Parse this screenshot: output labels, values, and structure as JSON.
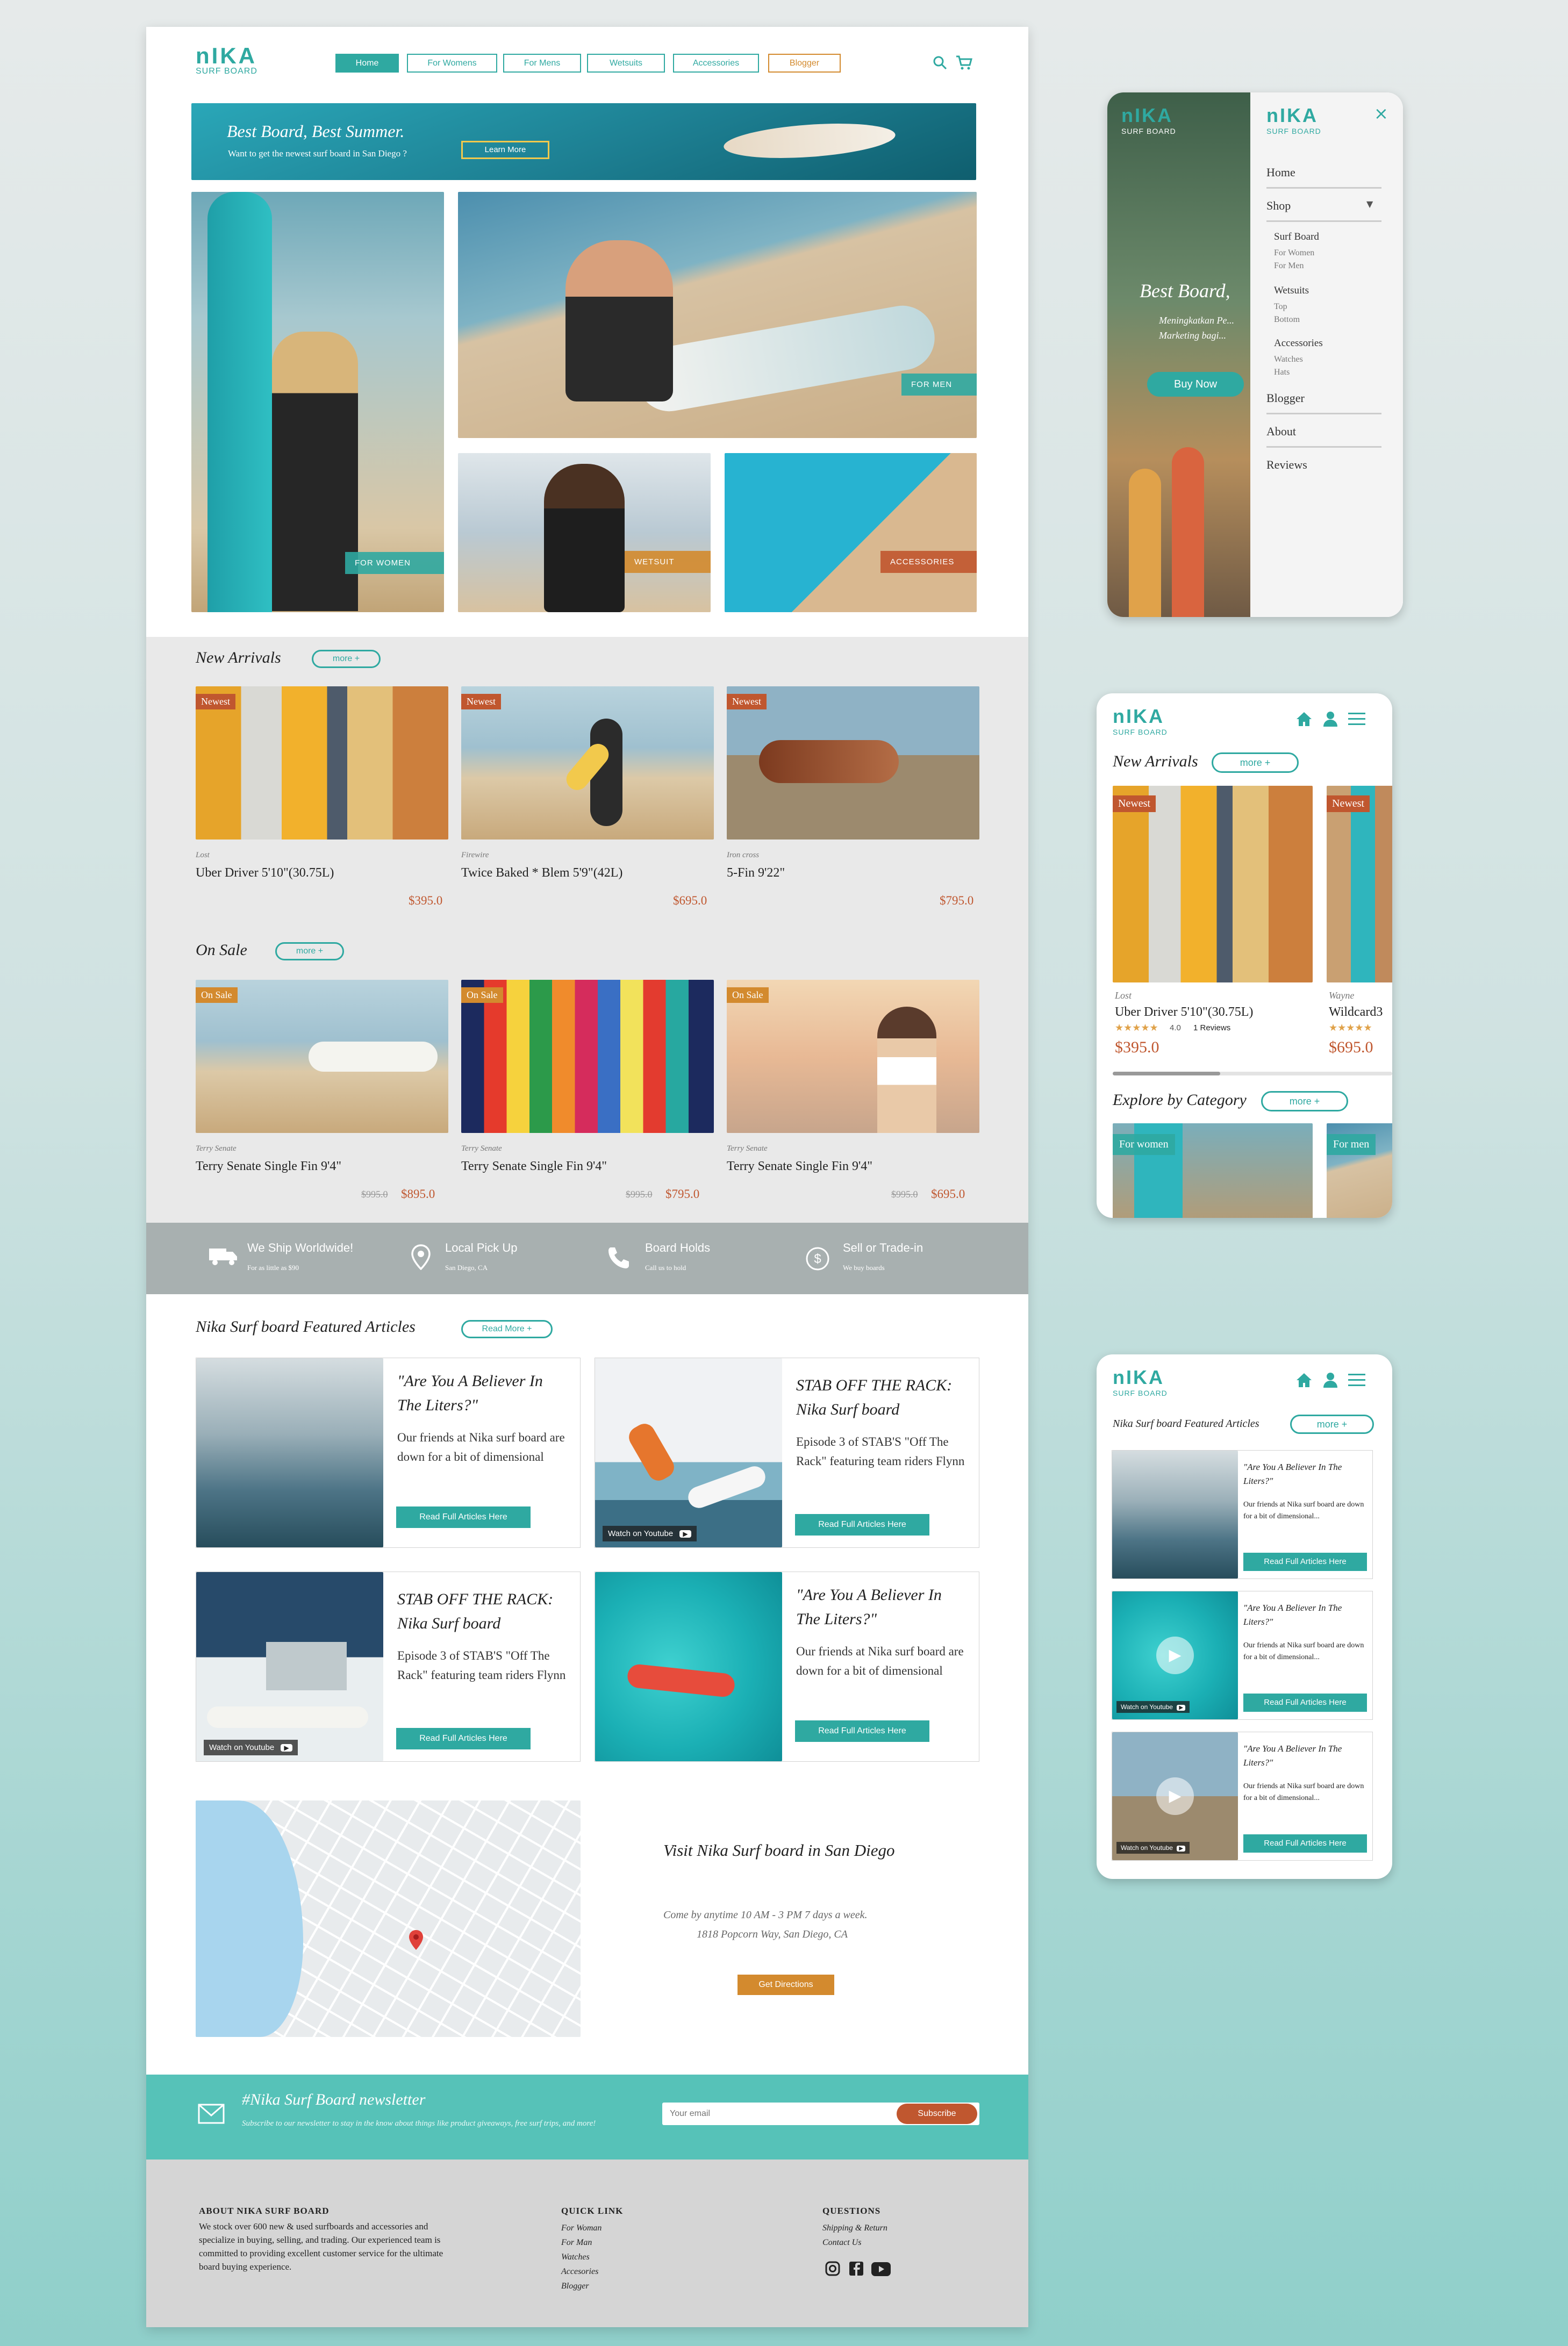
{
  "brand": {
    "logo": "nIKA",
    "sub": "SURF BOARD"
  },
  "nav": {
    "home": "Home",
    "women": "For Womens",
    "men": "For Mens",
    "wetsuits": "Wetsuits",
    "accessories": "Accessories",
    "blogger": "Blogger"
  },
  "hero": {
    "title": "Best Board, Best Summer.",
    "subtitle": "Want to get the newest surf board in San Diego ?",
    "cta": "Learn More"
  },
  "categories": {
    "women": "FOR WOMEN",
    "men": "FOR MEN",
    "wetsuit": "WETSUIT",
    "accessories": "ACCESSORIES"
  },
  "new_arrivals": {
    "title": "New Arrivals",
    "more": "more +",
    "badge": "Newest",
    "items": [
      {
        "brand": "Lost",
        "name": "Uber Driver 5'10\"(30.75L)",
        "price": "$395.0"
      },
      {
        "brand": "Firewire",
        "name": "Twice Baked * Blem 5'9\"(42L)",
        "price": "$695.0"
      },
      {
        "brand": "Iron cross",
        "name": "5-Fin 9'22\"",
        "price": "$795.0"
      }
    ]
  },
  "on_sale": {
    "title": "On Sale",
    "more": "more +",
    "badge": "On Sale",
    "items": [
      {
        "brand": "Terry Senate",
        "name": "Terry Senate Single Fin 9'4\"",
        "old": "$995.0",
        "price": "$895.0"
      },
      {
        "brand": "Terry Senate",
        "name": "Terry Senate Single Fin 9'4\"",
        "old": "$995.0",
        "price": "$795.0"
      },
      {
        "brand": "Terry Senate",
        "name": "Terry Senate Single Fin 9'4\"",
        "old": "$995.0",
        "price": "$695.0"
      }
    ]
  },
  "features": [
    {
      "title": "We Ship Worldwide!",
      "sub": "For as little as $90"
    },
    {
      "title": "Local Pick Up",
      "sub": "San Diego, CA"
    },
    {
      "title": "Board Holds",
      "sub": "Call us to hold"
    },
    {
      "title": "Sell or Trade-in",
      "sub": "We buy boards"
    }
  ],
  "articles": {
    "title": "Nika Surf board Featured Articles",
    "more": "Read More +",
    "read": "Read Full Articles Here",
    "yt": "Watch on Youtube",
    "items": [
      {
        "title": "\"Are You A Believer In The Liters?\"",
        "body": "Our friends at Nika surf board are down for a bit of dimensional"
      },
      {
        "title": "STAB OFF THE RACK: Nika Surf board",
        "body": "Episode 3 of STAB'S \"Off The Rack\" featuring team riders Flynn"
      },
      {
        "title": "STAB OFF THE RACK: Nika Surf board",
        "body": "Episode 3 of STAB'S \"Off The Rack\" featuring team riders Flynn"
      },
      {
        "title": "\"Are You A Believer In The Liters?\"",
        "body": "Our friends at Nika surf board are down for a bit of dimensional"
      }
    ]
  },
  "visit": {
    "title": "Visit Nika Surf board in San Diego",
    "hours": "Come by anytime 10 AM - 3 PM 7 days a week.",
    "address": "1818 Popcorn Way, San Diego, CA",
    "cta": "Get Directions"
  },
  "newsletter": {
    "title": "#Nika Surf Board newsletter",
    "text": "Subscribe to our newsletter to stay in the know about things like product giveaways, free surf trips, and more!",
    "placeholder": "Your email",
    "cta": "Subscribe"
  },
  "footer": {
    "about_h": "ABOUT NIKA SURF BOARD",
    "about": "We stock over 600 new & used surfboards and accessories and specialize in buying, selling, and trading. Our experienced team is committed to providing excellent customer service for the ultimate board buying experience.",
    "quick_h": "QUICK LINK",
    "quick": [
      "For Woman",
      "For Man",
      "Watches",
      "Accesories",
      "Blogger"
    ],
    "q_h": "QUESTIONS",
    "q": [
      "Shipping & Return",
      "Contact Us"
    ]
  },
  "mobile_menu": {
    "hero": "Best Board,",
    "hero_sub": "Meningkatkan Pe... Marketing bagi...",
    "cta": "Buy Now",
    "items": [
      "Home",
      "Shop",
      "Surf Board",
      "For Women",
      "For Men",
      "Wetsuits",
      "Top",
      "Bottom",
      "Accessories",
      "Watches",
      "Hats",
      "Blogger",
      "About",
      "Reviews"
    ]
  },
  "mobile_products": {
    "title": "New Arrivals",
    "more": "more +",
    "badge": "Newest",
    "p1_brand": "Lost",
    "p1_name": "Uber Driver 5'10\"(30.75L)",
    "p1_rating": "4.0",
    "p1_reviews": "1 Reviews",
    "p1_price": "$395.0",
    "p2_brand": "Wayne",
    "p2_name": "Wildcard3",
    "p2_price": "$695.0",
    "explore": "Explore by Category",
    "explore_more": "more +",
    "cat1": "For women",
    "cat2": "For men"
  },
  "mobile_articles": {
    "title": "Nika Surf board Featured Articles",
    "more": "more +",
    "a_title": "\"Are You A Believer In The Liters?\"",
    "a_body": "Our friends at Nika surf board are down for a bit of dimensional...",
    "read": "Read Full Articles Here",
    "yt": "Watch on Youtube"
  },
  "colors": {
    "teal": "#2fa9a1",
    "orange": "#d38a2e",
    "rust": "#c0572f"
  }
}
